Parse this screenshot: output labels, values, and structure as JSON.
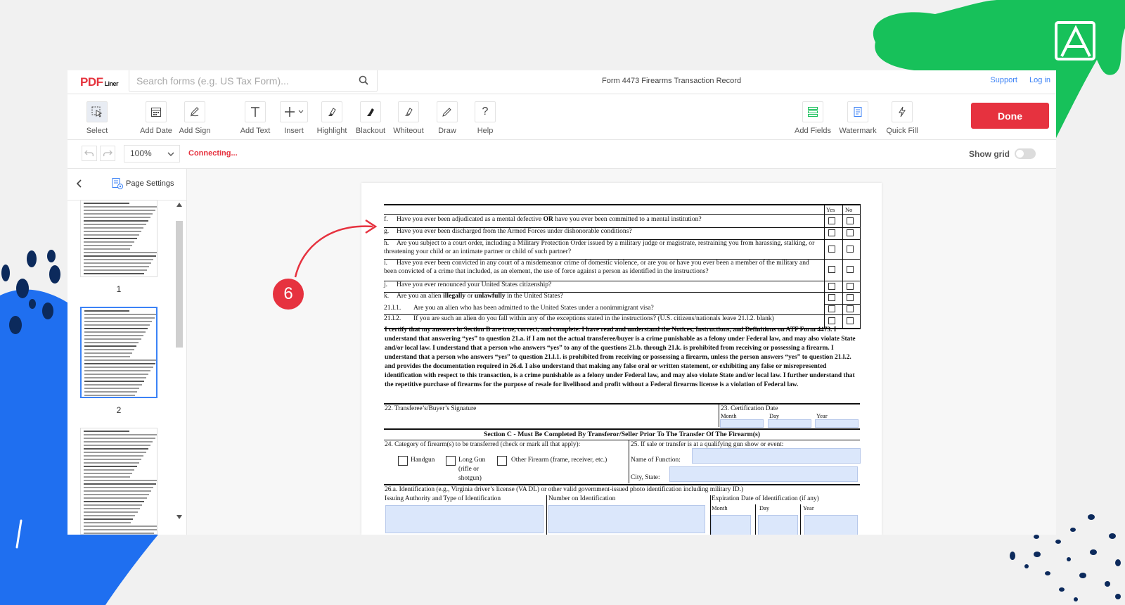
{
  "app": {
    "logo_pdf": "PDF",
    "logo_liner": "Liner",
    "search_placeholder": "Search forms (e.g. US Tax Form)...",
    "document_title": "Form 4473 Firearms Transaction Record",
    "support_link": "Support",
    "login_link": "Log in"
  },
  "toolbar": {
    "select": "Select",
    "add_date": "Add Date",
    "add_sign": "Add Sign",
    "add_text": "Add Text",
    "insert": "Insert",
    "highlight": "Highlight",
    "blackout": "Blackout",
    "whiteout": "Whiteout",
    "draw": "Draw",
    "help": "Help",
    "add_fields": "Add Fields",
    "watermark": "Watermark",
    "quick_fill": "Quick Fill",
    "done": "Done"
  },
  "subbar": {
    "zoom": "100%",
    "status": "Connecting...",
    "show_grid": "Show grid",
    "show_grid_on": false
  },
  "sidebar": {
    "page_settings": "Page Settings",
    "pages": [
      "1",
      "2"
    ]
  },
  "step_badge": "6",
  "colors": {
    "accent_red": "#e6323f",
    "link_blue": "#3b82f6",
    "deco_green": "#17c15a",
    "deco_blue": "#1f6ff0"
  },
  "form": {
    "col_yes": "Yes",
    "col_no": "No",
    "questions": [
      {
        "id": "f.",
        "html": "Have you ever been adjudicated as a mental defective <b>OR</b> have you ever been committed to a mental institution?"
      },
      {
        "id": "g.",
        "html": "Have you ever been discharged from the Armed Forces under dishonorable conditions?"
      },
      {
        "id": "h.",
        "html": "Are you subject to a court order, including a Military Protection Order issued by a military judge or magistrate, restraining you from harassing, stalking, or threatening your child or an intimate partner or child of such partner?"
      },
      {
        "id": "i.",
        "html": "Have you ever been convicted in any court of a misdemeanor crime of domestic violence, or are you or have you ever been a member of the military and been convicted of a crime that included, as an element, the use of force against a person as identified in the instructions?"
      },
      {
        "id": "j.",
        "html": "Have you ever renounced your United States citizenship?"
      },
      {
        "id": "k.",
        "html": "Are you an alien <b>illegally</b> or <b>unlawfully</b> in the United States?"
      },
      {
        "id": "21.l.1.",
        "html": "Are you an alien who has been admitted to the United States under a nonimmigrant visa?"
      },
      {
        "id": "21.l.2.",
        "html": "If you are such an alien do you fall within any of the exceptions stated in the instructions? (U.S. citizens/nationals leave 21.l.2. blank)"
      }
    ],
    "certification": "I certify that my answers in Section B are true, correct, and complete.  I have read and understand the Notices, Instructions, and Definitions on ATF Form 4473.  I understand that answering “yes” to question 21.a. if I am not the actual transferee/buyer is a crime punishable as a felony under Federal law, and may also violate State and/or local law.  I understand that a person who answers “yes” to any of the questions 21.b. through 21.k. is prohibited from receiving or possessing a firearm.  I understand that a person who answers “yes” to question 21.l.1. is prohibited from receiving or possessing a firearm, unless the person answers “yes” to question 21.l.2. and provides the documentation required in 26.d.  I also understand that making any false oral or written statement, or exhibiting any false or misrepresented identification with respect to this transaction, is a crime punishable as a felony under Federal law, and may also violate State and/or local law.  I further understand that the repetitive purchase of firearms for the purpose of resale for livelihood and profit without a Federal firearms license is a violation of Federal law.",
    "sig_label": "22.  Transferee’s/Buyer’s Signature",
    "cert_date_label": "23.  Certification Date",
    "month": "Month",
    "day": "Day",
    "year": "Year",
    "section_c": "Section C - Must Be Completed By Transferor/Seller Prior To The Transfer Of The Firearm(s)",
    "q24": "24.  Category of firearm(s) to be transferred (check or mark all that apply):",
    "handgun": "Handgun",
    "long_gun": "Long Gun",
    "long_gun_note1": "(rifle or",
    "long_gun_note2": "shotgun)",
    "other_firearm": "Other Firearm (frame, receiver, etc.)",
    "q25": "25.  If sale or transfer is at a qualifying gun show or event:",
    "name_function": "Name of Function:",
    "city_state": "City, State:",
    "q26a": "26.a. Identification (e.g., Virginia driver’s license (VA DL) or other valid government-issued photo identification including military ID.)",
    "issuing": "Issuing Authority and Type of Identification",
    "number_id": "Number on Identification",
    "expiration": "Expiration Date of Identification (if any)"
  }
}
